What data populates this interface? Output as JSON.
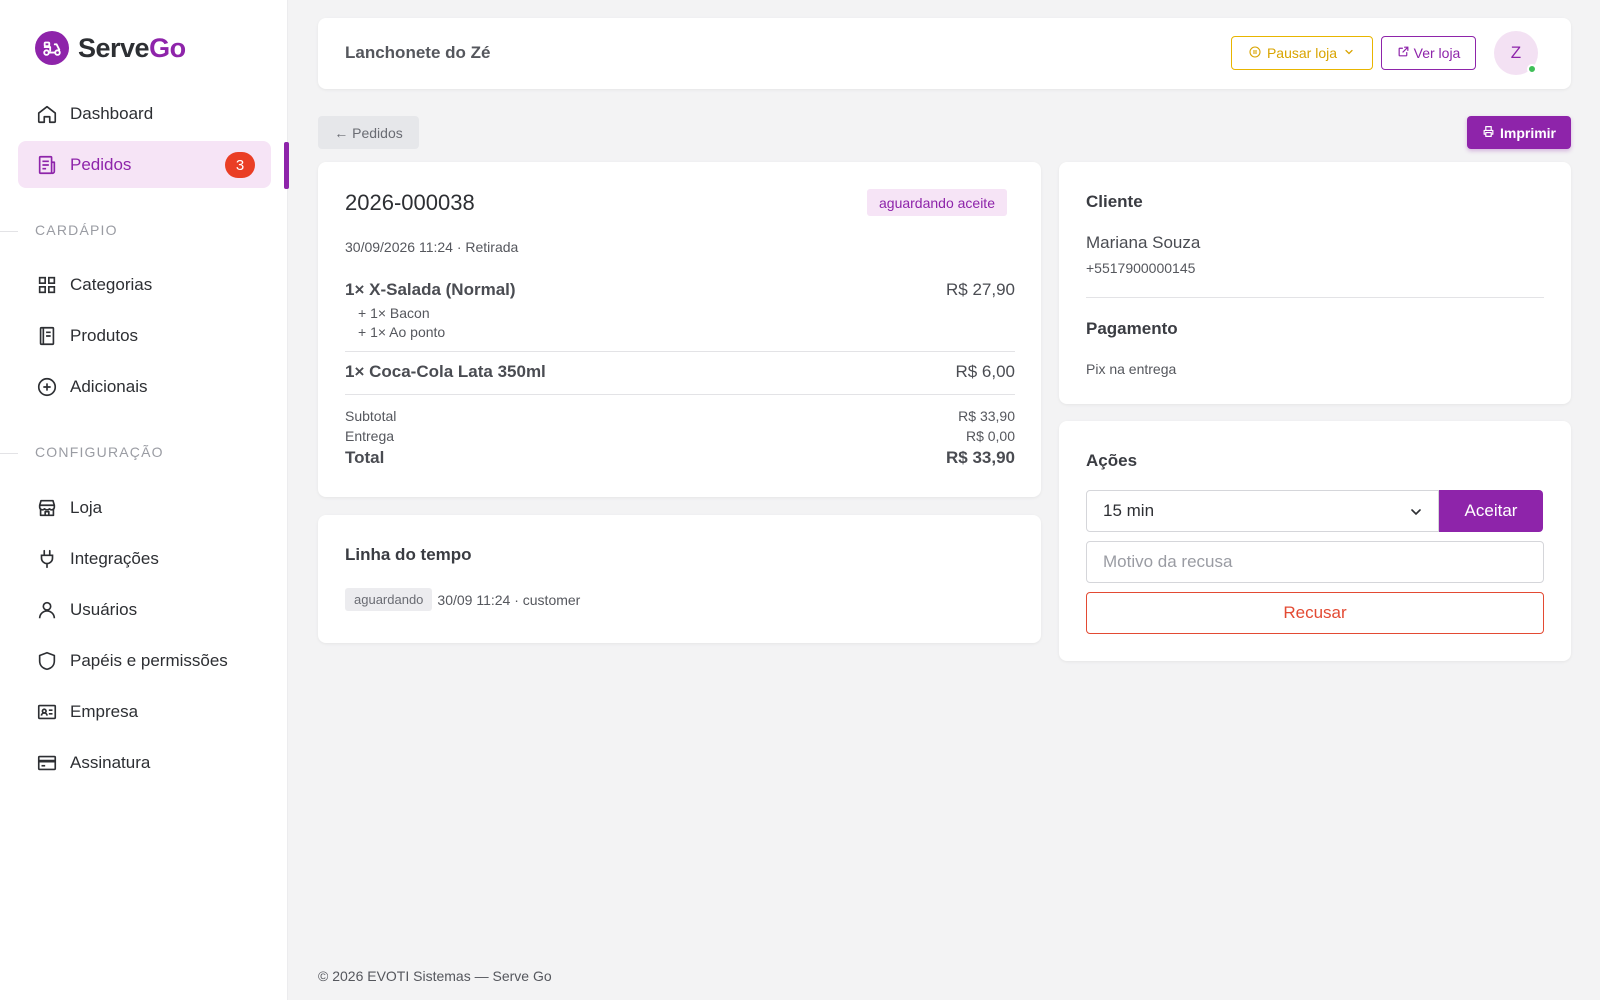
{
  "brand": {
    "name_part1": "Serve",
    "name_part2": "Go"
  },
  "sidebar": {
    "main": [
      {
        "label": "Dashboard",
        "icon": "home-icon"
      },
      {
        "label": "Pedidos",
        "icon": "receipt-icon",
        "badge": "3",
        "active": true
      }
    ],
    "section_menu": "CARDÁPIO",
    "menu": [
      {
        "label": "Categorias",
        "icon": "grid-icon"
      },
      {
        "label": "Produtos",
        "icon": "book-icon"
      },
      {
        "label": "Adicionais",
        "icon": "plus-circle-icon"
      }
    ],
    "section_config": "CONFIGURAÇÃO",
    "config": [
      {
        "label": "Loja",
        "icon": "store-icon"
      },
      {
        "label": "Integrações",
        "icon": "plug-icon"
      },
      {
        "label": "Usuários",
        "icon": "user-icon"
      },
      {
        "label": "Papéis e permissões",
        "icon": "shield-icon"
      },
      {
        "label": "Empresa",
        "icon": "id-card-icon"
      },
      {
        "label": "Assinatura",
        "icon": "credit-card-icon"
      }
    ]
  },
  "header": {
    "store_name": "Lanchonete do Zé",
    "pause_label": "Pausar loja",
    "view_label": "Ver loja",
    "avatar_initial": "Z"
  },
  "toolbar": {
    "back_label": "← Pedidos",
    "print_label": "Imprimir"
  },
  "order": {
    "code": "2026-000038",
    "status": "aguardando aceite",
    "meta": "30/09/2026 11:24 · Retirada",
    "items": [
      {
        "name": "1× X-Salada (Normal)",
        "price": "R$ 27,90",
        "addons": [
          "+ 1× Bacon",
          "+ 1× Ao ponto"
        ]
      },
      {
        "name": "1× Coca-Cola Lata 350ml",
        "price": "R$ 6,00",
        "addons": []
      }
    ],
    "subtotal_label": "Subtotal",
    "subtotal": "R$ 33,90",
    "delivery_label": "Entrega",
    "delivery": "R$ 0,00",
    "total_label": "Total",
    "total": "R$ 33,90"
  },
  "timeline": {
    "title": "Linha do tempo",
    "entries": [
      {
        "status": "aguardando",
        "text": "30/09 11:24 · customer"
      }
    ]
  },
  "client": {
    "title": "Cliente",
    "name": "Mariana Souza",
    "phone": "+5517900000145",
    "payment_title": "Pagamento",
    "payment_method": "Pix na entrega"
  },
  "actions": {
    "title": "Ações",
    "time_selected": "15 min",
    "accept_label": "Aceitar",
    "reason_placeholder": "Motivo da recusa",
    "refuse_label": "Recusar"
  },
  "footer": "© 2026 EVOTI Sistemas — Serve Go",
  "colors": {
    "brand": "#8e24aa",
    "danger": "#e34a33",
    "warning": "#e8b500",
    "online": "#3fbf58"
  }
}
